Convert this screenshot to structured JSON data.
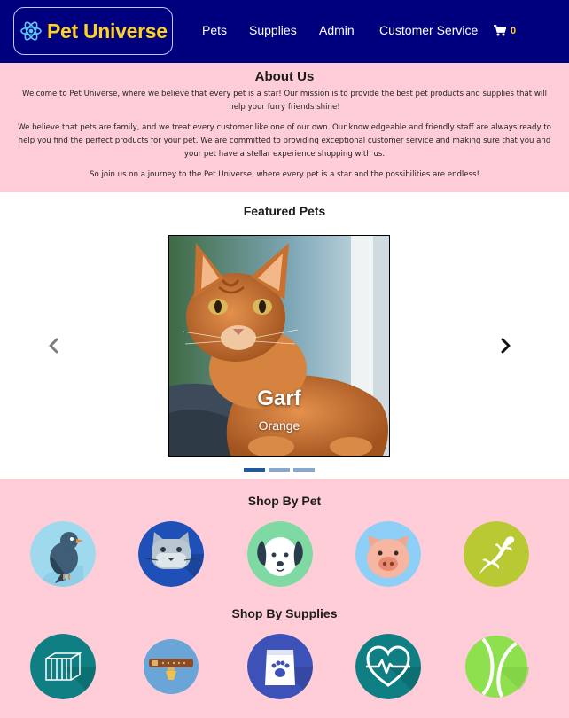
{
  "brand": {
    "name": "Pet Universe",
    "logo_icon": "react-atom-icon"
  },
  "nav": {
    "links": [
      "Pets",
      "Supplies",
      "Admin",
      "Customer Service"
    ],
    "cart_icon": "shopping-cart-icon",
    "cart_count": "0"
  },
  "about": {
    "title": "About Us",
    "p1": "Welcome to Pet Universe, where we believe that every pet is a star! Our mission is to provide the best pet products and supplies that will help your furry friends shine!",
    "p2": "We believe that pets are family, and we treat every customer like one of our own. Our knowledgeable and friendly staff are always ready to help you find the perfect products for your pet. We are committed to providing exceptional customer service and making sure that you and your pet have a stellar experience shopping with us.",
    "p3": "So join us on a journey to the Pet Universe, where every pet is a star and the possibilities are endless!"
  },
  "featured": {
    "title": "Featured Pets",
    "current": {
      "name": "Garf",
      "color": "Orange",
      "image": "orange-cat-photo"
    },
    "slide_count": 3,
    "active_slide": 1
  },
  "shop_by_pet": {
    "title": "Shop By Pet",
    "items": [
      "bird-icon",
      "cat-icon",
      "dog-icon",
      "pig-icon",
      "lizard-icon"
    ]
  },
  "shop_by_supplies": {
    "title": "Shop By Supplies",
    "items": [
      "crate-icon",
      "collar-icon",
      "pet-food-icon",
      "health-icon",
      "tennis-ball-icon"
    ]
  },
  "colors": {
    "navbar": "#00007e",
    "brand_text": "#ffd21f",
    "section_pink": "#ffcdd8",
    "dot_active": "#1f5aa0",
    "dot_inactive": "#88a9cf"
  }
}
